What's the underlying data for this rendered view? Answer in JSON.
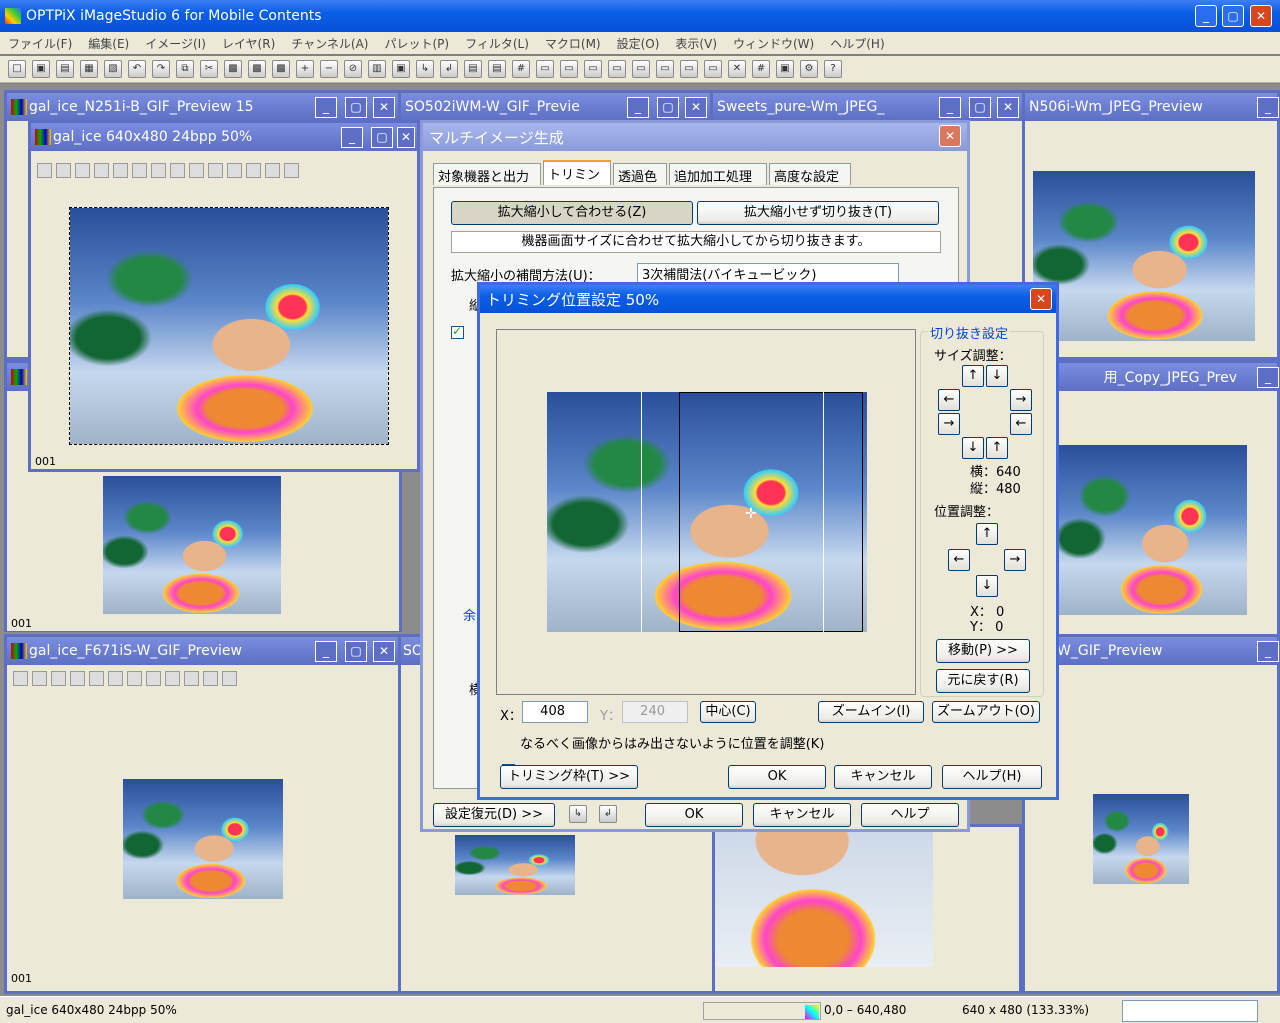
{
  "app": {
    "title": "OPTPiX iMageStudio 6 for Mobile Contents"
  },
  "menu": [
    "ファイル(F)",
    "編集(E)",
    "イメージ(I)",
    "レイヤ(R)",
    "チャンネル(A)",
    "パレット(P)",
    "フィルタ(L)",
    "マクロ(M)",
    "設定(O)",
    "表示(V)",
    "ウィンドウ(W)",
    "ヘルプ(H)"
  ],
  "children": {
    "w1": "gal_ice_N251i-B_GIF_Preview   15",
    "w2": "SO502iWM-W_GIF_Previe",
    "w3": "Sweets_pure-Wm_JPEG_",
    "w4": "N506i-Wm_JPEG_Preview",
    "w5": "gal_ice  640x480  24bpp  50%",
    "w6": "gal_ice_F671iS-W_GIF_Preview",
    "w7": "用_Copy_JPEG_Prev",
    "w8": "DiS-W_GIF_Preview",
    "w6b": "SO",
    "tab1": "001",
    "tab2": "001",
    "tab3": "001"
  },
  "multi": {
    "title": "マルチイメージ生成",
    "tabs": [
      "対象機器と出力",
      "トリミング",
      "透過色",
      "追加加工処理",
      "高度な設定"
    ],
    "fit_btn": "拡大縮小して合わせる(Z)",
    "crop_btn": "拡大縮小せず切り抜き(T)",
    "desc": "機器画面サイズに合わせて拡大縮小してから切り抜きます。",
    "interp_label": "拡大縮小の補間方法(U)：",
    "interp_value": "3次補間法(バイキュービック)",
    "restore": "設定復元(D) >>",
    "ok": "OK",
    "cancel": "キャンセル",
    "help": "ヘルプ",
    "margin": "余白",
    "frag1": "縦",
    "frag2": "ト",
    "frag3": "横"
  },
  "trim": {
    "title": "トリミング位置設定 50%",
    "group": "切り抜き設定",
    "size_label": "サイズ調整：",
    "w_label": "横：640",
    "h_label": "縦：480",
    "pos_label": "位置調整：",
    "x_read": "X：  0",
    "y_read": "Y：  0",
    "move": "移動(P) >>",
    "reset": "元に戻す(R)",
    "x_lbl": "X：",
    "x_val": "408",
    "y_lbl": "Y：",
    "y_val": "240",
    "center": "中心(C)",
    "zoomin": "ズームイン(I)",
    "zoomout": "ズームアウト(O)",
    "adjust": "なるべく画像からはみ出さないように位置を調整(K)",
    "frame": "トリミング枠(T) >>",
    "ok": "OK",
    "cancel": "キャンセル",
    "help": "ヘルプ(H)"
  },
  "status": {
    "name": "gal_ice  640x480  24bpp  50%",
    "coords": "0,0 – 640,480",
    "size": "640 x 480 (133.33%)"
  },
  "icons": [
    "minimize-icon",
    "maximize-icon",
    "close-icon",
    "arrow-up-icon",
    "arrow-down-icon",
    "arrow-left-icon",
    "arrow-right-icon",
    "help-icon",
    "zoom-icon"
  ]
}
